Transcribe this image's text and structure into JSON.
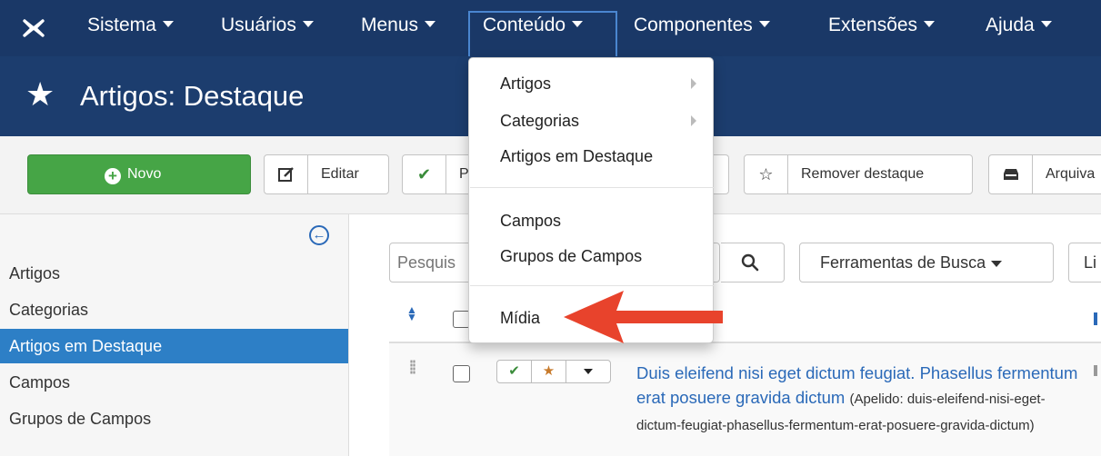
{
  "navbar": {
    "logo_icon": "joomla-logo-icon",
    "items": [
      {
        "label": "Sistema"
      },
      {
        "label": "Usuários"
      },
      {
        "label": "Menus"
      },
      {
        "label": "Conteúdo"
      },
      {
        "label": "Componentes"
      },
      {
        "label": "Extensões"
      },
      {
        "label": "Ajuda"
      }
    ],
    "active_item": "Conteúdo"
  },
  "title_bar": {
    "icon": "star-icon",
    "title": "Artigos: Destaque"
  },
  "toolbar": {
    "new_label": "Novo",
    "edit_label": "Editar",
    "publish_label": "P",
    "unfeature_label": "Remover destaque",
    "archive_label": "Arquiva"
  },
  "sidebar": {
    "items": [
      {
        "label": "Artigos"
      },
      {
        "label": "Categorias"
      },
      {
        "label": "Artigos em Destaque"
      },
      {
        "label": "Campos"
      },
      {
        "label": "Grupos de Campos"
      }
    ],
    "active_item": "Artigos em Destaque"
  },
  "search": {
    "placeholder": "Pesquis",
    "tools_label": "Ferramentas de Busca",
    "limit_label": "Li"
  },
  "table": {
    "rows": [
      {
        "title": "Duis eleifend nisi eget dictum feugiat. Phasellus fermentum erat posuere gravida dictum",
        "alias": "(Apelido: duis-eleifend-nisi-eget-dictum-feugiat-phasellus-fermentum-erat-posuere-gravida-dictum)"
      }
    ]
  },
  "dropdown": {
    "items": [
      {
        "label": "Artigos",
        "has_submenu": true
      },
      {
        "label": "Categorias",
        "has_submenu": true
      },
      {
        "label": "Artigos em Destaque",
        "has_submenu": false
      },
      {
        "label": "Campos",
        "has_submenu": false
      },
      {
        "label": "Grupos de Campos",
        "has_submenu": false
      },
      {
        "label": "Mídia",
        "has_submenu": false
      }
    ]
  },
  "annotation": {
    "arrow_color": "#e8432c",
    "points_to": "Mídia"
  },
  "colors": {
    "navbar": "#1a3867",
    "titlebar": "#1c3d6e",
    "accent_blue": "#2d7fc6",
    "new_button": "#46a546"
  }
}
